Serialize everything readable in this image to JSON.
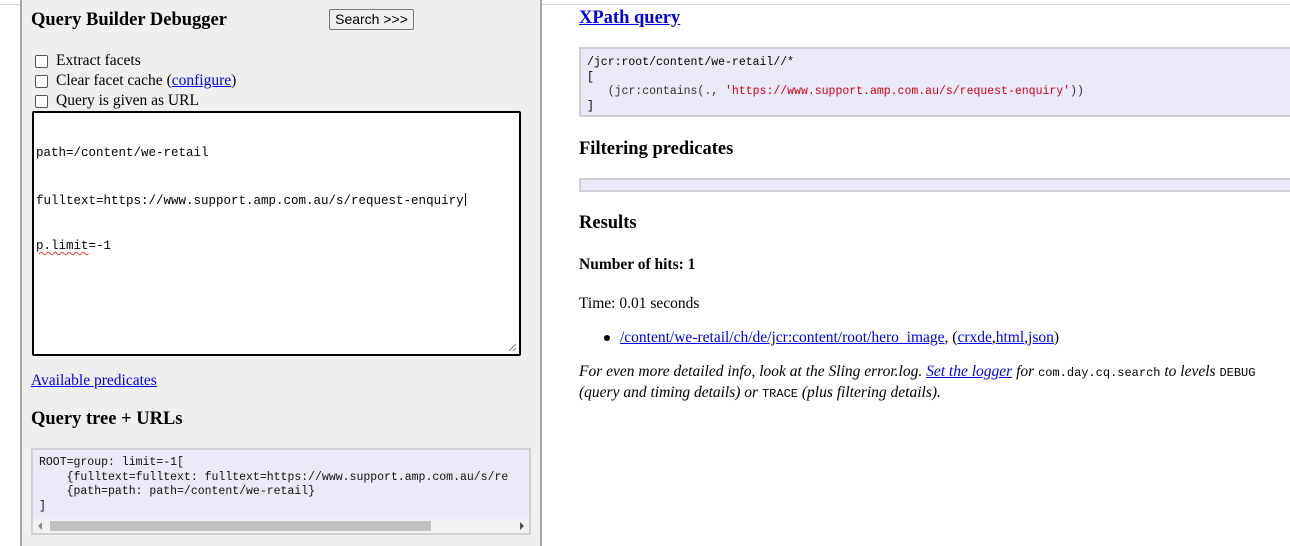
{
  "left": {
    "title": "Query Builder Debugger",
    "search_label": "Search >>>",
    "options": {
      "extract_facets": "Extract facets",
      "clear_cache_prefix": "Clear facet cache (",
      "clear_cache_link": "configure",
      "clear_cache_suffix": ")",
      "query_as_url": "Query is given as URL"
    },
    "query": {
      "line1": "path=/content/we-retail",
      "line2": "fulltext=https://www.support.amp.com.au/s/request-enquiry",
      "line3_misspelled": "p.limit",
      "line3_rest": "=-1"
    },
    "available_predicates": "Available predicates",
    "query_tree_title": "Query tree + URLs",
    "query_tree_code": "ROOT=group: limit=-1[\n    {fulltext=fulltext: fulltext=https://www.support.amp.com.au/s/re\n    {path=path: path=/content/we-retail}\n]"
  },
  "right": {
    "xpath_title": "XPath query",
    "xpath": {
      "line1": "/jcr:root/content/we-retail//*",
      "line2": "[",
      "line3_prefix": "   (jcr:contains(., ",
      "line3_string": "'https://www.support.amp.com.au/s/request-enquiry'",
      "line3_suffix": "))",
      "line4": "]"
    },
    "filtering_title": "Filtering predicates",
    "results_title": "Results",
    "hits": "Number of hits: 1",
    "time": "Time: 0.01 seconds",
    "result": {
      "path": "/content/we-retail/ch/de/jcr:content/root/hero_image",
      "sep1": ", (",
      "crxde": "crxde",
      "sep2": ", ",
      "html": "html",
      "sep3": ", ",
      "json": "json",
      "end": ")"
    },
    "info": {
      "part1": "For even more detailed info, look at the Sling error.log. ",
      "link": "Set the logger",
      "part2": " for ",
      "logger": "com.day.cq.search",
      "part3": " to levels ",
      "debug": "DEBUG",
      "part4": " (query and timing details) or ",
      "trace": "TRACE",
      "part5": " (plus filtering details)."
    }
  },
  "colors": {
    "link": "#0000ee",
    "code_bg": "#e9e9f7",
    "panel_bg": "#efefef",
    "xpath_string": "#d0021b"
  }
}
